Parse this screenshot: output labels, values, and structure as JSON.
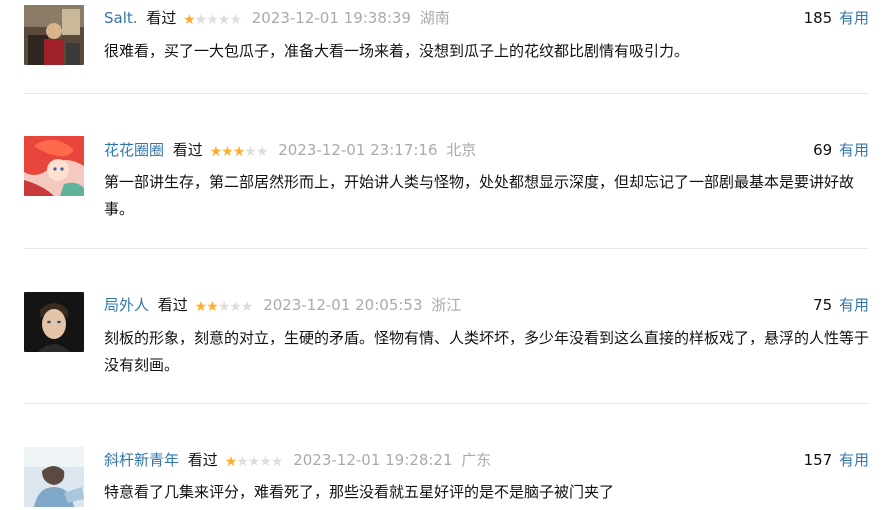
{
  "comments": [
    {
      "user": "Salt.",
      "status": "看过",
      "rating": 1,
      "time": "2023-12-01 19:38:39",
      "location": "湖南",
      "votes": "185",
      "useful_label": "有用",
      "text": "很难看，买了一大包瓜子，准备大看一场来着，没想到瓜子上的花纹都比剧情有吸引力。",
      "avatar": "avatar-photo-man-indoor"
    },
    {
      "user": "花花圈圈",
      "status": "看过",
      "rating": 3,
      "time": "2023-12-01 23:17:16",
      "location": "北京",
      "votes": "69",
      "useful_label": "有用",
      "text": "第一部讲生存，第二部居然形而上，开始讲人类与怪物，处处都想显示深度，但却忘记了一部剧最基本是要讲好故事。",
      "avatar": "avatar-cartoon-mermaid"
    },
    {
      "user": "局外人",
      "status": "看过",
      "rating": 2,
      "time": "2023-12-01 20:05:53",
      "location": "浙江",
      "votes": "75",
      "useful_label": "有用",
      "text": "刻板的形象，刻意的对立，生硬的矛盾。怪物有情、人类坏坏，多少年没看到这么直接的样板戏了，悬浮的人性等于没有刻画。",
      "avatar": "avatar-photo-dark-portrait"
    },
    {
      "user": "斜杆新青年",
      "status": "看过",
      "rating": 1,
      "time": "2023-12-01 19:28:21",
      "location": "广东",
      "votes": "157",
      "useful_label": "有用",
      "text": "特意看了几集来评分，难看死了，那些没看就五星好评的是不是脑子被门夹了",
      "avatar": "avatar-photo-light-blue"
    }
  ],
  "colors": {
    "link": "#3377aa",
    "meta": "#aaaaaa",
    "star_on": "#ffac2d",
    "star_off": "#dddddd",
    "divider": "#e8e8e8"
  }
}
